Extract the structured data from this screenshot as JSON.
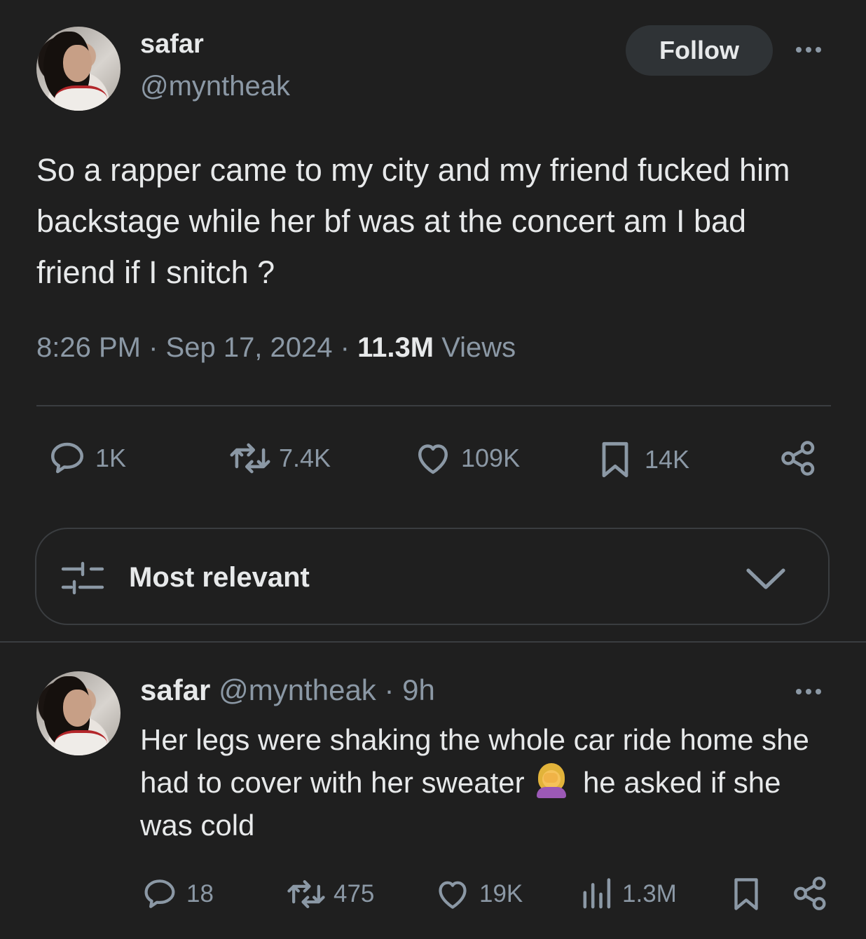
{
  "tweet": {
    "author_name": "safar",
    "author_handle": "@myntheak",
    "follow_label": "Follow",
    "text": "So a rapper came to my city and my friend fucked him backstage while her bf was at the concert am I bad friend if I snitch ?",
    "time": "8:26 PM",
    "date": "Sep 17, 2024",
    "views_count": "11.3M",
    "views_label": "Views",
    "stats": {
      "replies": "1K",
      "reposts": "7.4K",
      "likes": "109K",
      "bookmarks": "14K"
    }
  },
  "sort": {
    "label": "Most relevant"
  },
  "reply": {
    "author_name": "safar",
    "author_handle": "@myntheak",
    "age": "9h",
    "text_part1": "Her legs were shaking the whole car ride home she had to cover with her sweater",
    "text_part2": "he asked if she was cold",
    "emoji": "woman-facepalming-emoji",
    "stats": {
      "replies": "18",
      "reposts": "475",
      "likes": "19K",
      "views": "1.3M"
    }
  },
  "colors": {
    "background": "#1f1f1f",
    "primary_text": "#e7e9ea",
    "secondary_text": "#8b98a5",
    "divider": "#3a3d40",
    "follow_button_bg": "#2f3336"
  }
}
